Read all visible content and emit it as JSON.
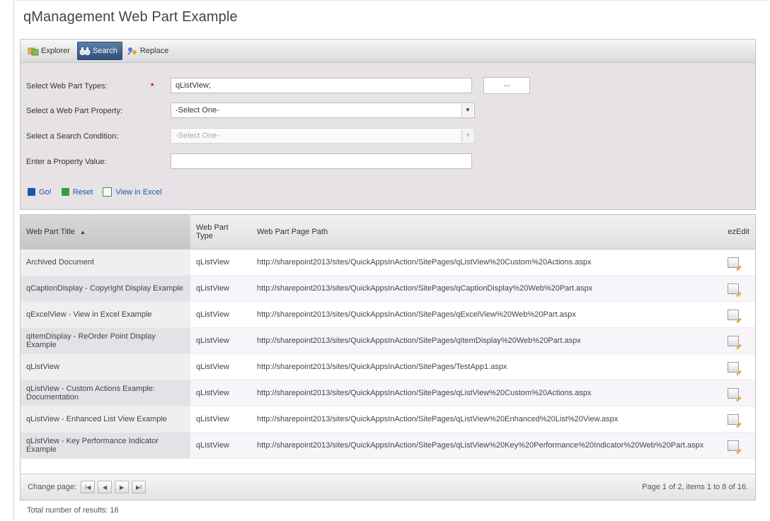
{
  "page": {
    "title": "qManagement Web Part Example"
  },
  "tabs": [
    {
      "label": "Explorer",
      "icon": "explorer-icon",
      "active": false
    },
    {
      "label": "Search",
      "icon": "binoculars-icon",
      "active": true
    },
    {
      "label": "Replace",
      "icon": "replace-icon",
      "active": false
    }
  ],
  "form": {
    "types_label": "Select Web Part Types:",
    "required_mark": "*",
    "types_value": "qListView;",
    "browse_label": "...",
    "property_label": "Select a Web Part Property:",
    "property_value": "-Select One-",
    "condition_label": "Select a Search Condition:",
    "condition_value": "-Select One-",
    "value_label": "Enter a Property Value:",
    "value_value": ""
  },
  "actions": {
    "go": "Go!",
    "reset": "Reset",
    "excel": "View in Excel"
  },
  "grid": {
    "headers": {
      "title": "Web Part Title",
      "sort_glyph": "▲",
      "type": "Web Part Type",
      "path": "Web Part Page Path",
      "edit": "ezEdit"
    },
    "rows": [
      {
        "title": "Archived Document",
        "type": "qListView",
        "path": "http://sharepoint2013/sites/QuickAppsInAction/SitePages/qListView%20Custom%20Actions.aspx"
      },
      {
        "title": "qCaptionDisplay - Copyright Display Example",
        "type": "qListView",
        "path": "http://sharepoint2013/sites/QuickAppsInAction/SitePages/qCaptionDisplay%20Web%20Part.aspx"
      },
      {
        "title": "qExcelView - View in Excel Example",
        "type": "qListView",
        "path": "http://sharepoint2013/sites/QuickAppsInAction/SitePages/qExcelView%20Web%20Part.aspx"
      },
      {
        "title": "qItemDisplay - ReOrder Point Display Example",
        "type": "qListView",
        "path": "http://sharepoint2013/sites/QuickAppsInAction/SitePages/qItemDisplay%20Web%20Part.aspx"
      },
      {
        "title": "qListView",
        "type": "qListView",
        "path": "http://sharepoint2013/sites/QuickAppsInAction/SitePages/TestApp1.aspx"
      },
      {
        "title": "qListView - Custom Actions Example: Documentation",
        "type": "qListView",
        "path": "http://sharepoint2013/sites/QuickAppsInAction/SitePages/qListView%20Custom%20Actions.aspx"
      },
      {
        "title": "qListView - Enhanced List View Example",
        "type": "qListView",
        "path": "http://sharepoint2013/sites/QuickAppsInAction/SitePages/qListView%20Enhanced%20List%20View.aspx"
      },
      {
        "title": "qListView - Key Performance Indicator Example",
        "type": "qListView",
        "path": "http://sharepoint2013/sites/QuickAppsInAction/SitePages/qListView%20Key%20Performance%20Indicator%20Web%20Part.aspx"
      }
    ]
  },
  "pager": {
    "label": "Change page:",
    "first": "I◀",
    "prev": "◀",
    "next": "▶",
    "last": "▶I",
    "info": "Page 1 of 2, items 1 to 8 of 16."
  },
  "footer": {
    "total": "Total number of results: 16"
  },
  "colors": {
    "tab_active": "#2f4f79",
    "link": "#1f57a5",
    "required": "#cc0000",
    "panel_bg": "#e6e2e6"
  }
}
